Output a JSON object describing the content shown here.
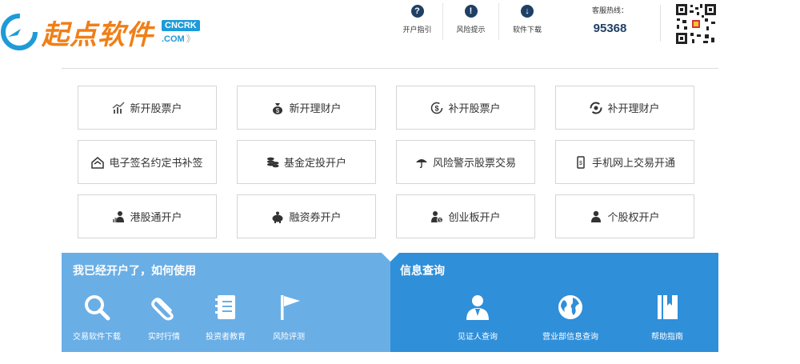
{
  "header": {
    "logo_text": "起点软件",
    "badge_top": "CNCRK",
    "badge_bottom": ".COM",
    "badge_suffix": "》",
    "top_links": [
      {
        "label": "开户指引",
        "icon": "question-icon",
        "glyph": "?"
      },
      {
        "label": "风险提示",
        "icon": "warning-icon",
        "glyph": "!"
      },
      {
        "label": "软件下载",
        "icon": "download-icon",
        "glyph": "↓"
      }
    ],
    "hotline_label": "客服热线：",
    "hotline_number": "95368"
  },
  "grid": {
    "items": [
      {
        "label": "新开股票户",
        "icon": "chart-icon"
      },
      {
        "label": "新开理财户",
        "icon": "money-bag-icon"
      },
      {
        "label": "补开股票户",
        "icon": "dollar-refresh-icon"
      },
      {
        "label": "补开理财户",
        "icon": "refresh-icon"
      },
      {
        "label": "电子签名约定书补签",
        "icon": "signature-icon"
      },
      {
        "label": "基金定投开户",
        "icon": "coins-icon"
      },
      {
        "label": "风险警示股票交易",
        "icon": "umbrella-icon"
      },
      {
        "label": "手机网上交易开通",
        "icon": "phone-icon"
      },
      {
        "label": "港股通开户",
        "icon": "person-chart-icon"
      },
      {
        "label": "融资券开户",
        "icon": "piggy-bank-icon"
      },
      {
        "label": "创业板开户",
        "icon": "person-money-icon"
      },
      {
        "label": "个股权开户",
        "icon": "person-icon"
      }
    ]
  },
  "panel_left": {
    "title": "我已经开户了，如何使用",
    "items": [
      {
        "label": "交易软件下载",
        "icon": "magnifier-icon"
      },
      {
        "label": "实时行情",
        "icon": "paperclip-icon"
      },
      {
        "label": "投资者教育",
        "icon": "notebook-icon"
      },
      {
        "label": "风险评测",
        "icon": "flag-icon"
      }
    ]
  },
  "panel_right": {
    "title": "信息查询",
    "items": [
      {
        "label": "见证人查询",
        "icon": "user-icon"
      },
      {
        "label": "营业部信息查询",
        "icon": "globe-icon"
      },
      {
        "label": "帮助指南",
        "icon": "book-icon"
      }
    ]
  },
  "colors": {
    "logo_orange": "#f07f17",
    "brand_blue": "#1e9bd8",
    "navy": "#1f3f66",
    "panel_light": "#6aaee6",
    "panel_dark": "#2f8fd9"
  }
}
